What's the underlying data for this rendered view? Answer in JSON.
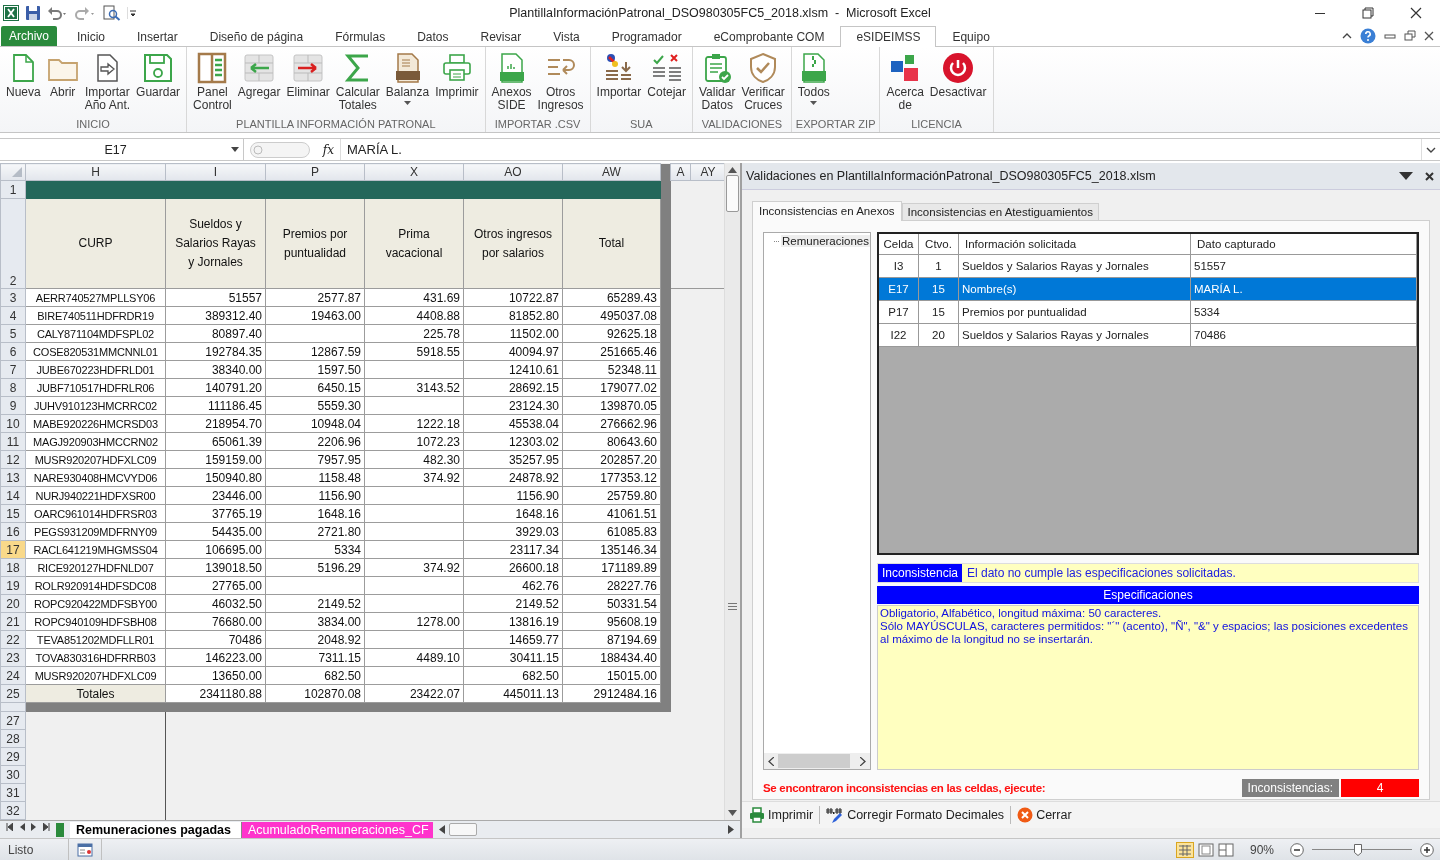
{
  "window": {
    "title": "PlantillaInformaciónPatronal_DSO980305FC5_2018.xlsm  -  Microsoft Excel"
  },
  "ribbon": {
    "file_tab": "Archivo",
    "tabs": [
      {
        "label": "Inicio",
        "selected": false
      },
      {
        "label": "Insertar",
        "selected": false
      },
      {
        "label": "Diseño de página",
        "selected": false
      },
      {
        "label": "Fórmulas",
        "selected": false
      },
      {
        "label": "Datos",
        "selected": false
      },
      {
        "label": "Revisar",
        "selected": false
      },
      {
        "label": "Vista",
        "selected": false
      },
      {
        "label": "Programador",
        "selected": false
      },
      {
        "label": "eComprobante COM",
        "selected": false
      },
      {
        "label": "eSIDEIMSS",
        "selected": true
      },
      {
        "label": "Equipo",
        "selected": false
      }
    ],
    "groups": [
      {
        "label": "INICIO",
        "buttons": [
          {
            "label": "Nueva"
          },
          {
            "label": "Abrir"
          },
          {
            "label": "Importar\nAño Ant."
          },
          {
            "label": "Guardar"
          }
        ]
      },
      {
        "label": "PLANTILLA INFORMACIÓN PATRONAL",
        "buttons": [
          {
            "label": "Panel\nControl"
          },
          {
            "label": "Agregar"
          },
          {
            "label": "Eliminar"
          },
          {
            "label": "Calcular\nTotales"
          },
          {
            "label": "Balanza",
            "dropdown": true
          },
          {
            "label": "Imprimir"
          }
        ]
      },
      {
        "label": "IMPORTAR .CSV",
        "buttons": [
          {
            "label": "Anexos\nSIDE"
          },
          {
            "label": "Otros\nIngresos"
          }
        ]
      },
      {
        "label": "SUA",
        "buttons": [
          {
            "label": "Importar"
          },
          {
            "label": "Cotejar"
          }
        ]
      },
      {
        "label": "VALIDACIONES",
        "buttons": [
          {
            "label": "Validar\nDatos"
          },
          {
            "label": "Verificar\nCruces"
          }
        ]
      },
      {
        "label": "EXPORTAR ZIP",
        "buttons": [
          {
            "label": "Todos",
            "dropdown": true
          }
        ]
      },
      {
        "label": "LICENCIA",
        "buttons": [
          {
            "label": "Acerca\nde"
          },
          {
            "label": "Desactivar"
          }
        ]
      }
    ]
  },
  "formula_bar": {
    "name_box": "E17",
    "function_label": "fx",
    "value": "MARÍA L."
  },
  "sheet": {
    "columns": [
      "H",
      "I",
      "P",
      "X",
      "AO",
      "AW",
      "A",
      "AY"
    ],
    "header_rows": [
      "1",
      "2"
    ],
    "headers": [
      "CURP",
      "Sueldos y Salarios Rayas y Jornales",
      "Premios por puntualidad",
      "Prima vacacional",
      "Otros ingresos por salarios",
      "Total"
    ],
    "rows": [
      {
        "row": "3",
        "selected": false,
        "cells": [
          "AERR740527MPLLSY06",
          "51557",
          "2577.87",
          "431.69",
          "10722.87",
          "65289.43"
        ]
      },
      {
        "row": "4",
        "selected": false,
        "cells": [
          "BIRE740511HDFRDR19",
          "389312.40",
          "19463.00",
          "4408.88",
          "81852.80",
          "495037.08"
        ]
      },
      {
        "row": "5",
        "selected": false,
        "cells": [
          "CALY871104MDFSPL02",
          "80897.40",
          null,
          "225.78",
          "11502.00",
          "92625.18"
        ]
      },
      {
        "row": "6",
        "selected": false,
        "cells": [
          "COSE820531MMCNNL01",
          "192784.35",
          "12867.59",
          "5918.55",
          "40094.97",
          "251665.46"
        ]
      },
      {
        "row": "7",
        "selected": false,
        "cells": [
          "JUBE670223HDFRLD01",
          "38340.00",
          "1597.50",
          null,
          "12410.61",
          "52348.11"
        ]
      },
      {
        "row": "8",
        "selected": false,
        "cells": [
          "JUBF710517HDFRLR06",
          "140791.20",
          "6450.15",
          "3143.52",
          "28692.15",
          "179077.02"
        ]
      },
      {
        "row": "9",
        "selected": false,
        "cells": [
          "JUHV910123HMCRRC02",
          "111186.45",
          "5559.30",
          null,
          "23124.30",
          "139870.05"
        ]
      },
      {
        "row": "10",
        "selected": false,
        "cells": [
          "MABE920226HMCRSD03",
          "218954.70",
          "10948.04",
          "1222.18",
          "45538.04",
          "276662.96"
        ]
      },
      {
        "row": "11",
        "selected": false,
        "cells": [
          "MAGJ920903HMCCRN02",
          "65061.39",
          "2206.96",
          "1072.23",
          "12303.02",
          "80643.60"
        ]
      },
      {
        "row": "12",
        "selected": false,
        "cells": [
          "MUSR920207HDFXLC09",
          "159159.00",
          "7957.95",
          "482.30",
          "35257.95",
          "202857.20"
        ]
      },
      {
        "row": "13",
        "selected": false,
        "cells": [
          "NARE930408HMCVYD06",
          "150940.80",
          "1158.48",
          "374.92",
          "24878.92",
          "177353.12"
        ]
      },
      {
        "row": "14",
        "selected": false,
        "cells": [
          "NURJ940221HDFXSR00",
          "23446.00",
          "1156.90",
          null,
          "1156.90",
          "25759.80"
        ]
      },
      {
        "row": "15",
        "selected": false,
        "cells": [
          "OARC961014HDFRSR03",
          "37765.19",
          "1648.16",
          null,
          "1648.16",
          "41061.51"
        ]
      },
      {
        "row": "16",
        "selected": false,
        "cells": [
          "PEGS931209MDFRNY09",
          "54435.00",
          "2721.80",
          null,
          "3929.03",
          "61085.83"
        ]
      },
      {
        "row": "17",
        "selected": true,
        "cells": [
          "RACL641219MHGMSS04",
          "106695.00",
          "5334",
          null,
          "23117.34",
          "135146.34"
        ]
      },
      {
        "row": "18",
        "selected": false,
        "cells": [
          "RICE920127HDFNLD07",
          "139018.50",
          "5196.29",
          "374.92",
          "26600.18",
          "171189.89"
        ]
      },
      {
        "row": "19",
        "selected": false,
        "cells": [
          "ROLR920914HDFSDC08",
          "27765.00",
          null,
          null,
          "462.76",
          "28227.76"
        ]
      },
      {
        "row": "20",
        "selected": false,
        "cells": [
          "ROPC920422MDFSBY00",
          "46032.50",
          "2149.52",
          null,
          "2149.52",
          "50331.54"
        ]
      },
      {
        "row": "21",
        "selected": false,
        "cells": [
          "ROPC940109HDFSBH08",
          "76680.00",
          "3834.00",
          "1278.00",
          "13816.19",
          "95608.19"
        ]
      },
      {
        "row": "22",
        "selected": false,
        "cells": [
          "TEVA851202MDFLLR01",
          "70486",
          "2048.92",
          null,
          "14659.77",
          "87194.69"
        ]
      },
      {
        "row": "23",
        "selected": false,
        "cells": [
          "TOVA830316HDFRRB03",
          "146223.00",
          "7311.15",
          "4489.10",
          "30411.15",
          "188434.40"
        ]
      },
      {
        "row": "24",
        "selected": false,
        "cells": [
          "MUSR920207HDFXLC09",
          "13650.00",
          "682.50",
          null,
          "682.50",
          "15015.00"
        ]
      }
    ],
    "totals": {
      "row": "25",
      "label": "Totales",
      "cells": [
        "2341180.88",
        "102870.08",
        "23422.07",
        "445011.13",
        "2912484.16"
      ]
    },
    "empty_rows": [
      "27",
      "28",
      "29",
      "30",
      "31",
      "32"
    ]
  },
  "sheet_tabs": [
    {
      "label": "Remuneraciones pagadas",
      "selected": true
    },
    {
      "label": "AcumuladoRemuneraciones_CF",
      "selected": false
    }
  ],
  "panel": {
    "title": "Validaciones en PlantillaInformaciónPatronal_DSO980305FC5_2018.xlsm",
    "tabs": [
      {
        "label": "Inconsistencias en Anexos",
        "selected": true
      },
      {
        "label": "Inconsistencias en Atestiguamientos",
        "selected": false
      }
    ],
    "tree": [
      "Remuneraciones"
    ],
    "grid": {
      "columns": [
        "Celda",
        "Ctvo.",
        "Información solicitada",
        "Dato capturado"
      ],
      "rows": [
        {
          "selected": false,
          "cells": [
            "I3",
            "1",
            "Sueldos y Salarios Rayas y Jornales",
            "51557"
          ]
        },
        {
          "selected": true,
          "cells": [
            "E17",
            "15",
            "Nombre(s)",
            "MARÍA L."
          ]
        },
        {
          "selected": false,
          "cells": [
            "P17",
            "15",
            "Premios por puntualidad",
            "5334"
          ]
        },
        {
          "selected": false,
          "cells": [
            "I22",
            "20",
            "Sueldos y Salarios Rayas y Jornales",
            "70486"
          ]
        }
      ]
    },
    "inconsistency_label": "Inconsistencia",
    "inconsistency_message": "El dato no cumple las especificaciones solicitadas.",
    "spec_header": "Especificaciones",
    "spec_lines": [
      "Obligatorio, Alfabético, longitud máxima: 50 caracteres.",
      "Sólo MAYÚSCULAS, caracteres permitidos: \"´\" (acento), \"Ñ\", \"&\" y espacios; las posiciones excedentes al máximo de la longitud no se insertarán."
    ],
    "footer_message": "Se encontraron inconsistencias en las celdas, ejecute:",
    "count_label": "Inconsistencias:",
    "count": "4",
    "buttons": [
      {
        "kind": "print",
        "label": "Imprimir"
      },
      {
        "kind": "decimals",
        "label": "Corregir Formato Decimales"
      },
      {
        "kind": "close",
        "label": "Cerrar"
      }
    ]
  },
  "status_bar": {
    "status": "Listo",
    "zoom": "90%",
    "zoom_slider": {
      "level": 0.46
    }
  }
}
